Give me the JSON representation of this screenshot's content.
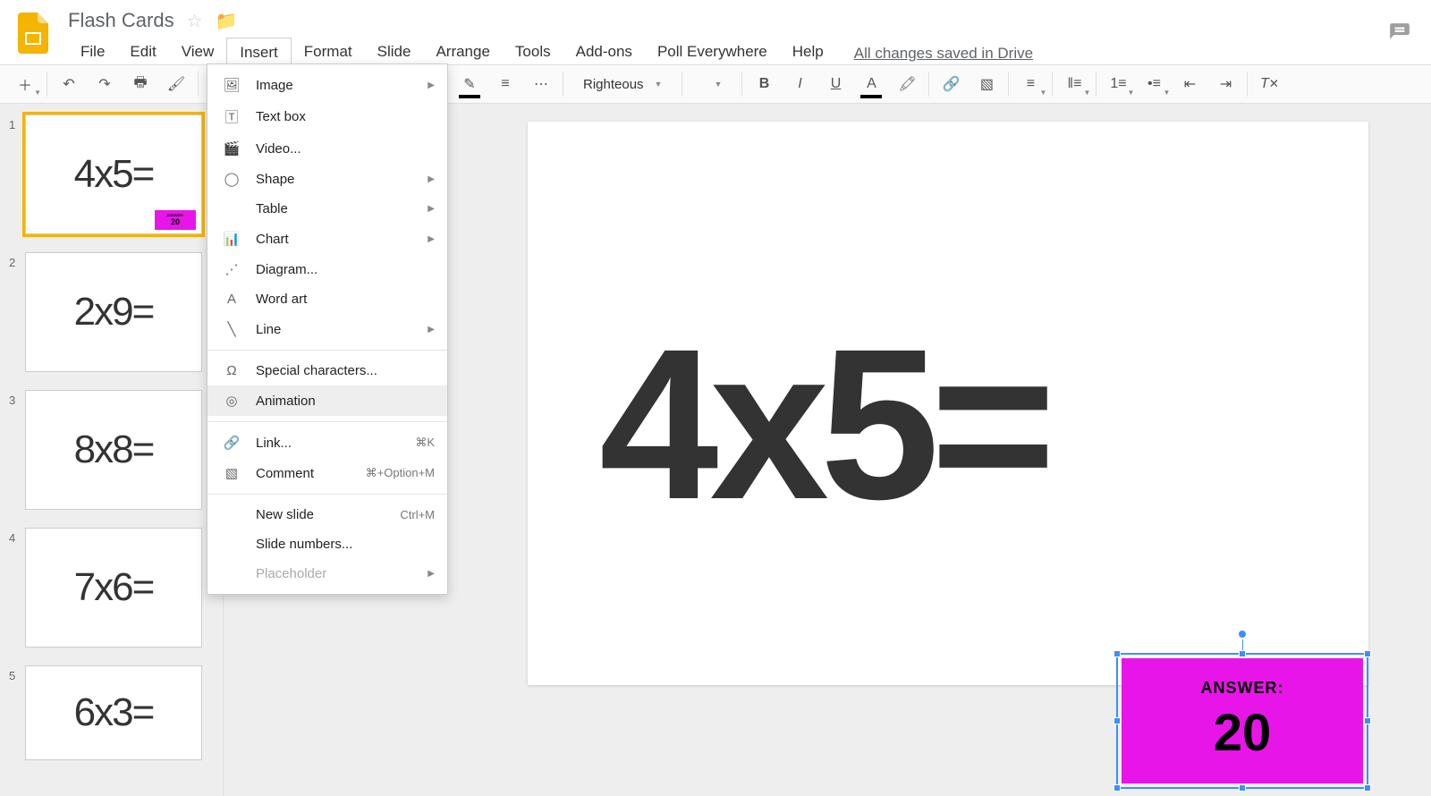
{
  "doc": {
    "title": "Flash Cards",
    "save_status": "All changes saved in Drive"
  },
  "menus": [
    "File",
    "Edit",
    "View",
    "Insert",
    "Format",
    "Slide",
    "Arrange",
    "Tools",
    "Add-ons",
    "Poll Everywhere",
    "Help"
  ],
  "active_menu_index": 3,
  "toolbar": {
    "font": "Righteous"
  },
  "insert_menu": {
    "items": [
      {
        "icon": "image",
        "label": "Image",
        "sub": true
      },
      {
        "icon": "textbox",
        "label": "Text box"
      },
      {
        "icon": "video",
        "label": "Video..."
      },
      {
        "icon": "shape",
        "label": "Shape",
        "sub": true
      },
      {
        "icon": "",
        "label": "Table",
        "sub": true
      },
      {
        "icon": "chart",
        "label": "Chart",
        "sub": true
      },
      {
        "icon": "diagram",
        "label": "Diagram..."
      },
      {
        "icon": "wordart",
        "label": "Word art"
      },
      {
        "icon": "line",
        "label": "Line",
        "sub": true
      },
      {
        "sep": true
      },
      {
        "icon": "omega",
        "label": "Special characters..."
      },
      {
        "icon": "animation",
        "label": "Animation",
        "hover": true
      },
      {
        "sep": true
      },
      {
        "icon": "link",
        "label": "Link...",
        "shortcut": "⌘K"
      },
      {
        "icon": "comment",
        "label": "Comment",
        "shortcut": "⌘+Option+M"
      },
      {
        "sep": true
      },
      {
        "icon": "",
        "label": "New slide",
        "shortcut": "Ctrl+M"
      },
      {
        "icon": "",
        "label": "Slide numbers..."
      },
      {
        "icon": "",
        "label": "Placeholder",
        "sub": true,
        "disabled": true
      }
    ]
  },
  "thumbnails": [
    {
      "num": "1",
      "text": "4x5=",
      "selected": true,
      "badge": true
    },
    {
      "num": "2",
      "text": "2x9="
    },
    {
      "num": "3",
      "text": "8x8="
    },
    {
      "num": "4",
      "text": "7x6="
    },
    {
      "num": "5",
      "text": "6x3=",
      "cut": true
    }
  ],
  "main_slide": {
    "equation": "4x5=",
    "answer_label": "ANSWER:",
    "answer_value": "20"
  },
  "colors": {
    "accent": "#e815e8",
    "selection": "#3f8efc"
  }
}
